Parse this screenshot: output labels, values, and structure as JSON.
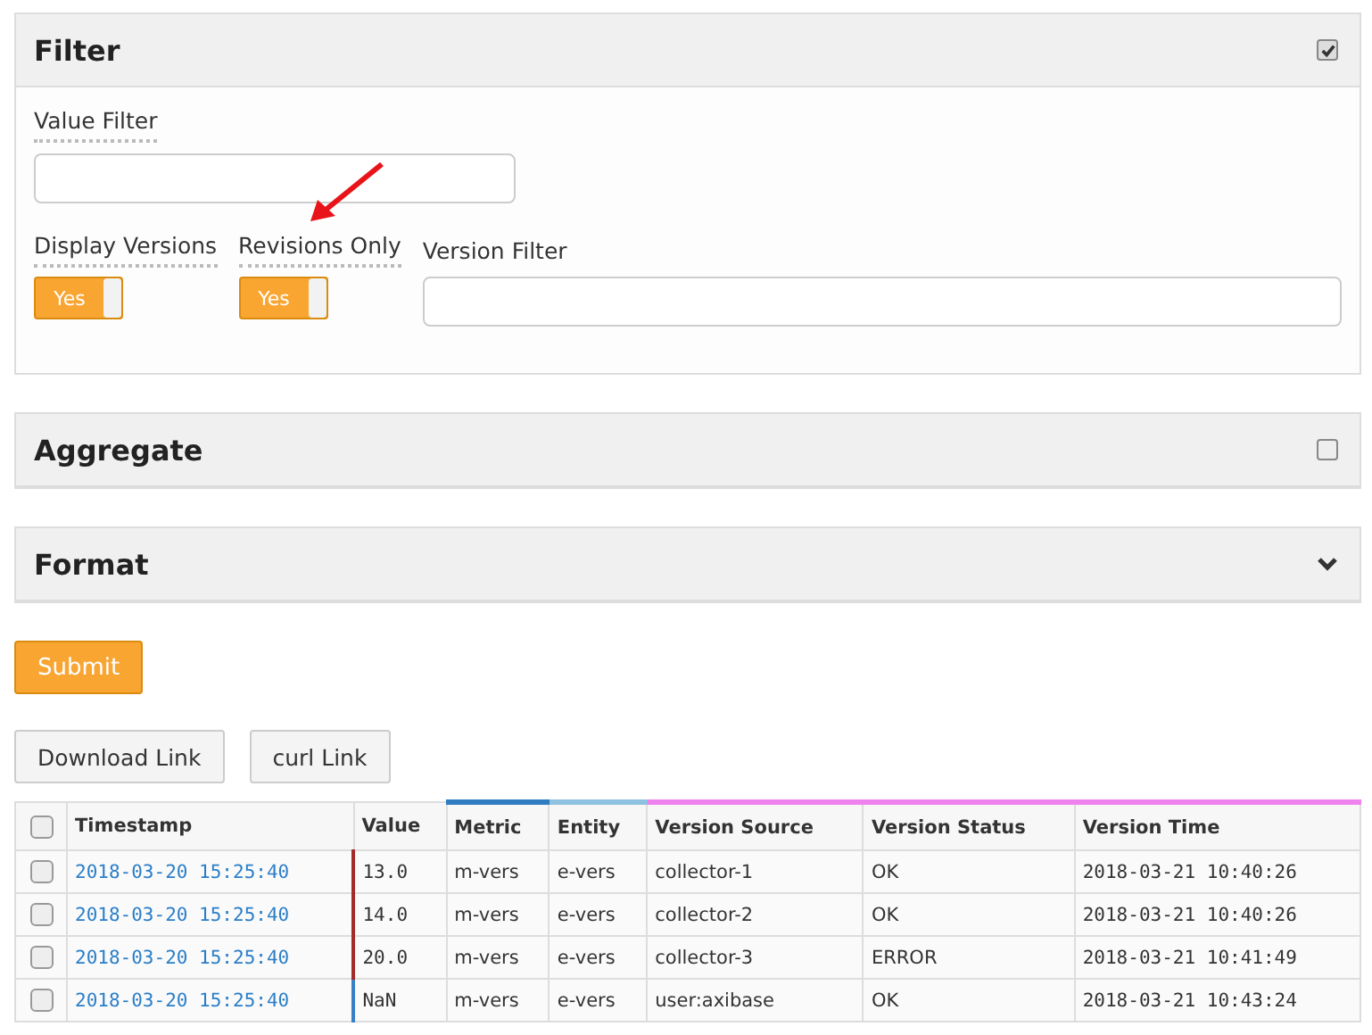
{
  "panels": [
    {
      "title": "Filter",
      "kind": "checkbox",
      "checked": true
    },
    {
      "title": "Aggregate",
      "kind": "checkbox",
      "checked": false
    },
    {
      "title": "Format",
      "kind": "chevron"
    }
  ],
  "filter": {
    "value_filter": {
      "label": "Value Filter"
    },
    "toggles": [
      {
        "label": "Display Versions",
        "on": true,
        "text": "Yes"
      },
      {
        "label": "Revisions Only",
        "on": true,
        "text": "Yes"
      }
    ],
    "version_filter": {
      "label": "Version Filter"
    }
  },
  "submit": "Submit",
  "links": [
    "Download Link",
    "curl Link"
  ],
  "table": {
    "select_all_checked": false,
    "columns": [
      {
        "label": "Timestamp"
      },
      {
        "label": "Value"
      },
      {
        "label": "Metric",
        "color": "#2f7dc0"
      },
      {
        "label": "Entity",
        "color": "#8fc1e0"
      },
      {
        "label": "Version Source",
        "color": "#ee82ee"
      },
      {
        "label": "Version Status",
        "color": "#ee82ee"
      },
      {
        "label": "Version Time",
        "color": "#ee82ee"
      }
    ],
    "rows": [
      {
        "checked": false,
        "color": "#a52a2a",
        "cells": [
          "2018-03-20 15:25:40",
          "13.0",
          "m-vers",
          "e-vers",
          "collector-1",
          "OK",
          "2018-03-21 10:40:26"
        ]
      },
      {
        "checked": false,
        "color": "#a52a2a",
        "cells": [
          "2018-03-20 15:25:40",
          "14.0",
          "m-vers",
          "e-vers",
          "collector-2",
          "OK",
          "2018-03-21 10:40:26"
        ]
      },
      {
        "checked": false,
        "color": "#a52a2a",
        "cells": [
          "2018-03-20 15:25:40",
          "20.0",
          "m-vers",
          "e-vers",
          "collector-3",
          "ERROR",
          "2018-03-21 10:41:49"
        ]
      },
      {
        "checked": false,
        "color": "#3a7fc4",
        "cells": [
          "2018-03-20 15:25:40",
          "NaN",
          "m-vers",
          "e-vers",
          "user:axibase",
          "OK",
          "2018-03-21 10:43:24"
        ]
      }
    ]
  }
}
